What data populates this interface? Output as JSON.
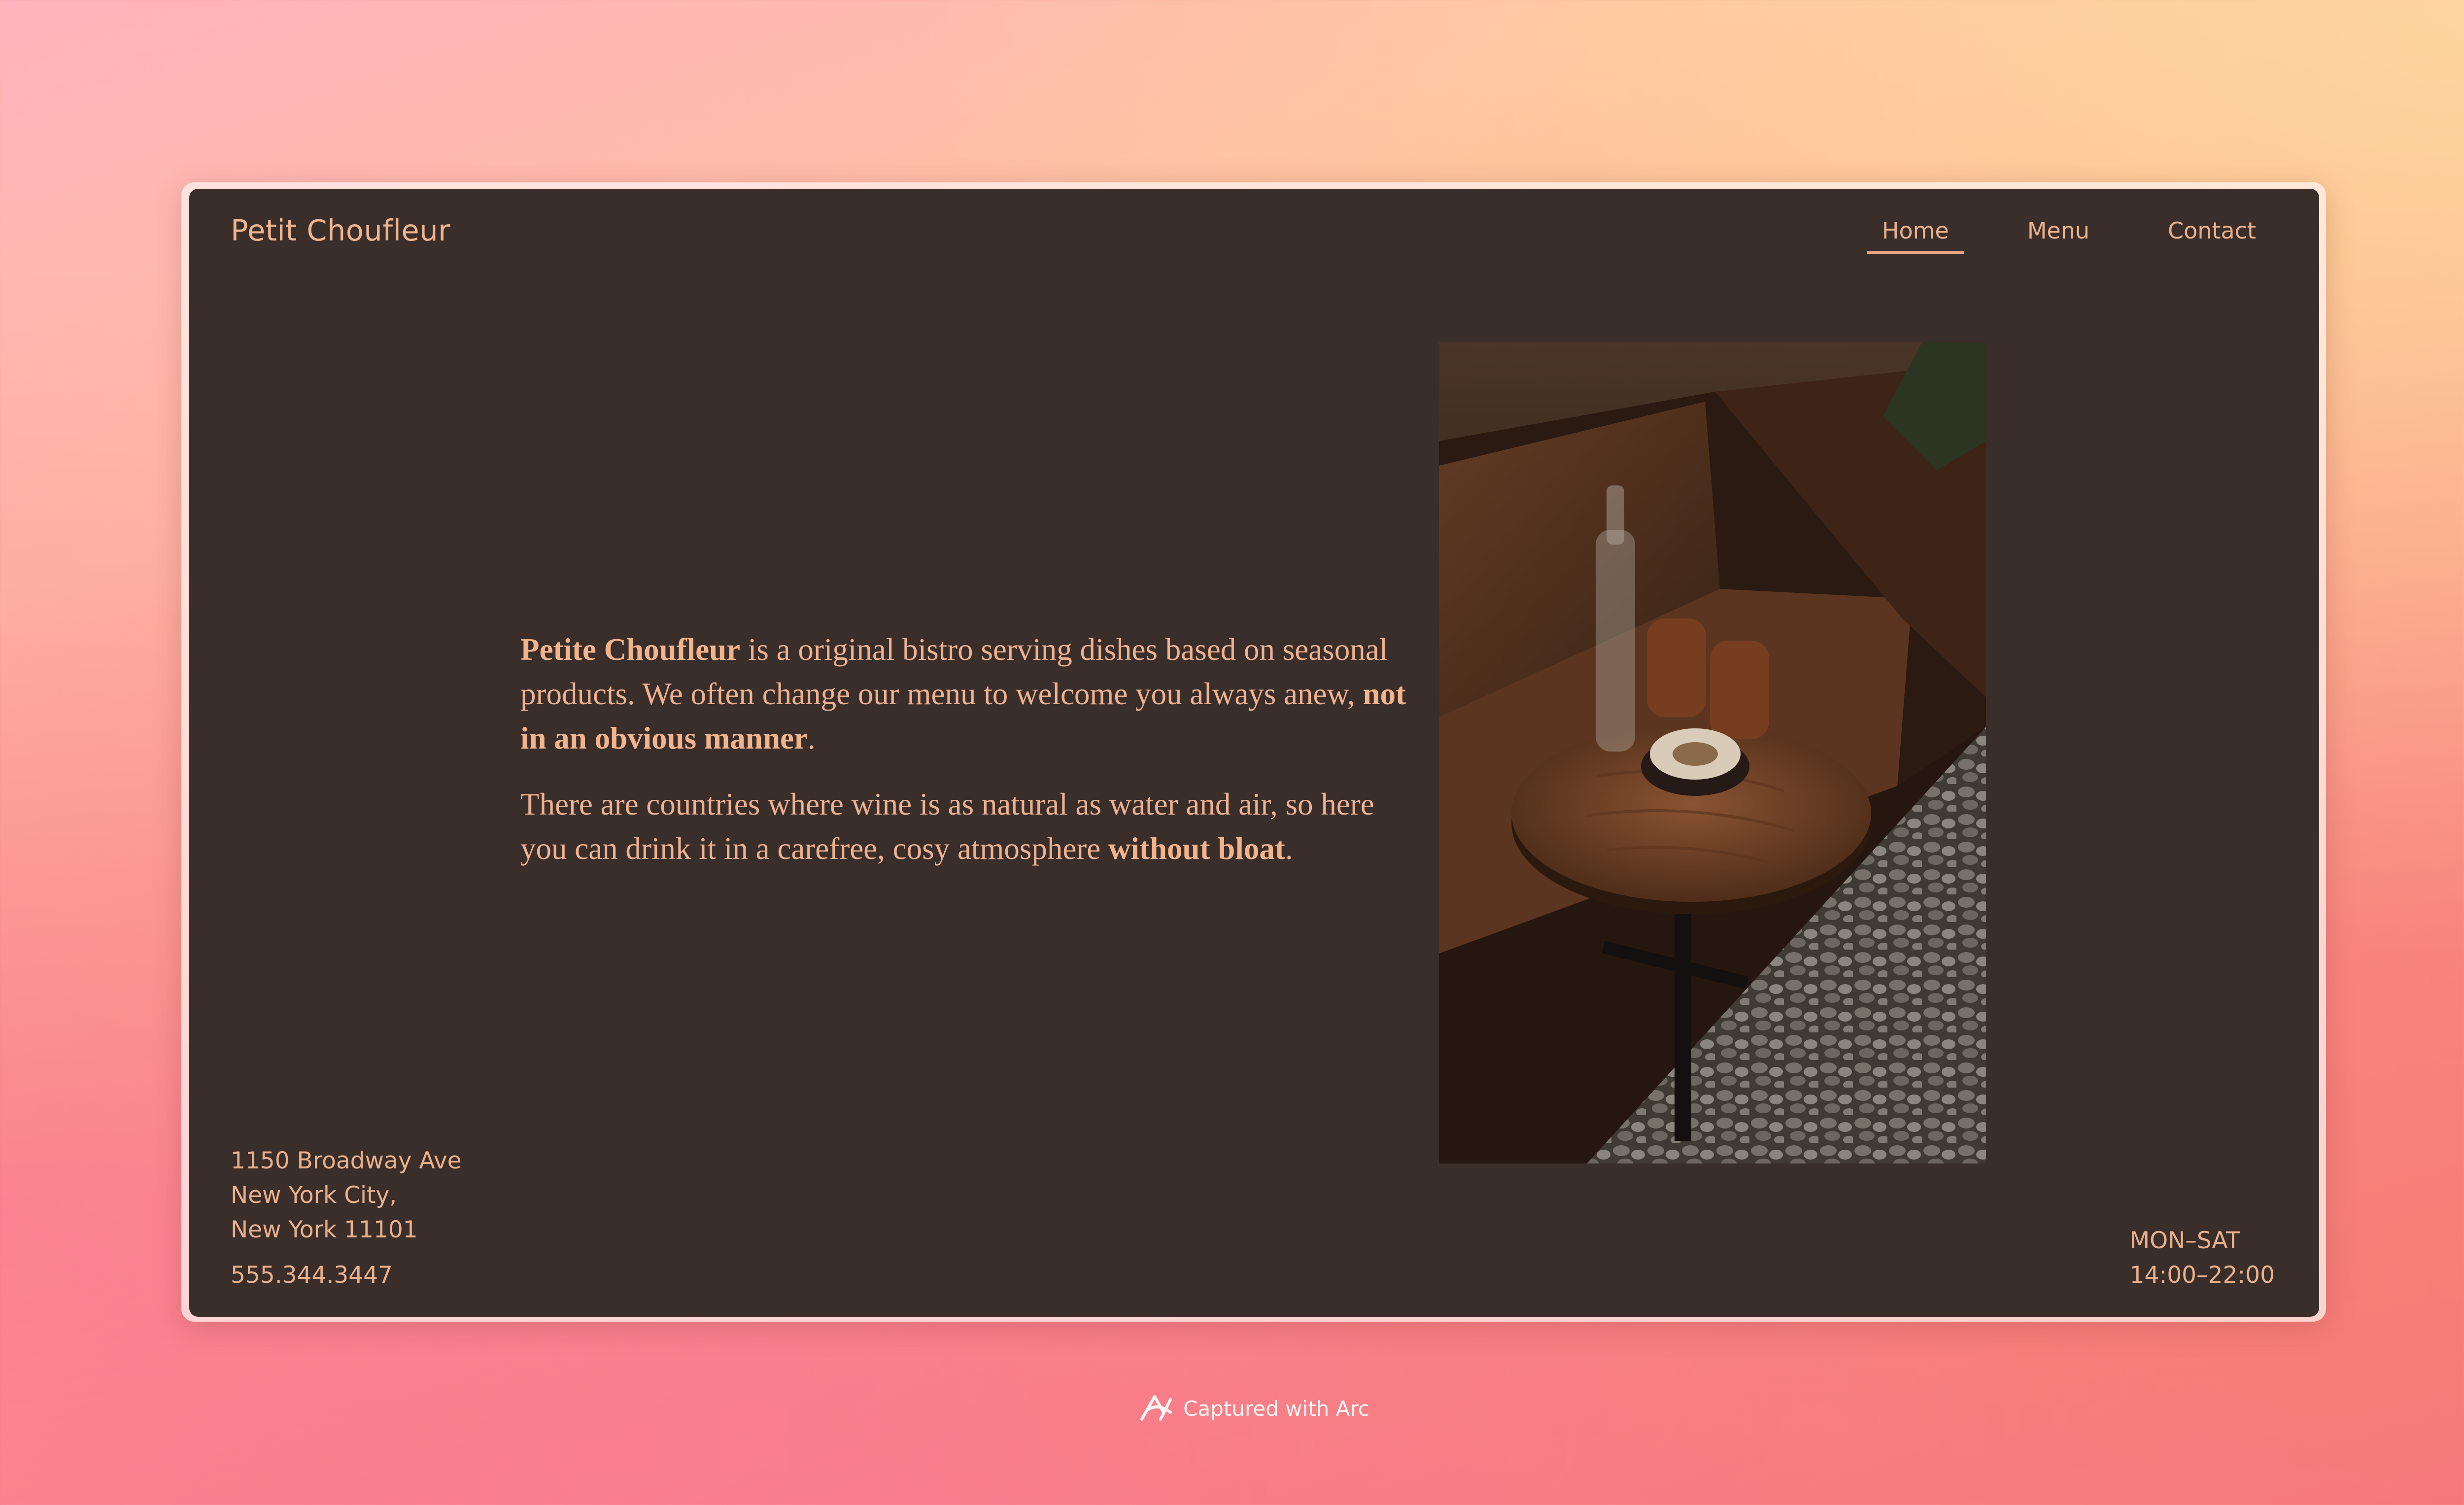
{
  "site": {
    "brand": "Petit Choufleur"
  },
  "nav": {
    "items": [
      {
        "label": "Home",
        "active": true
      },
      {
        "label": "Menu",
        "active": false
      },
      {
        "label": "Contact",
        "active": false
      }
    ]
  },
  "intro": {
    "p1": {
      "brand_bold": "Petite Choufleur",
      "text": " is a original bistro serving dishes based on seasonal products. We often change our menu to welcome you always anew, ",
      "emphasis": "not in an obvious manner",
      "end": "."
    },
    "p2": {
      "text": "There are countries where wine is as natural as water and air, so here you can drink it in a carefree, cosy atmosphere ",
      "emphasis": "without bloat",
      "end": "."
    }
  },
  "photo": {
    "icon": "bistro-table-photo"
  },
  "address": {
    "line1": "1150 Broadway Ave",
    "line2": "New York City,",
    "line3": "New York 11101",
    "phone": "555.344.3447"
  },
  "hours": {
    "days": "MON–SAT",
    "time": "14:00–22:00"
  },
  "caption": {
    "text": "Captured with Arc",
    "icon": "arc-logo-icon"
  },
  "colors": {
    "window_bg": "#3a2e2b",
    "accent": "#eab08b"
  }
}
